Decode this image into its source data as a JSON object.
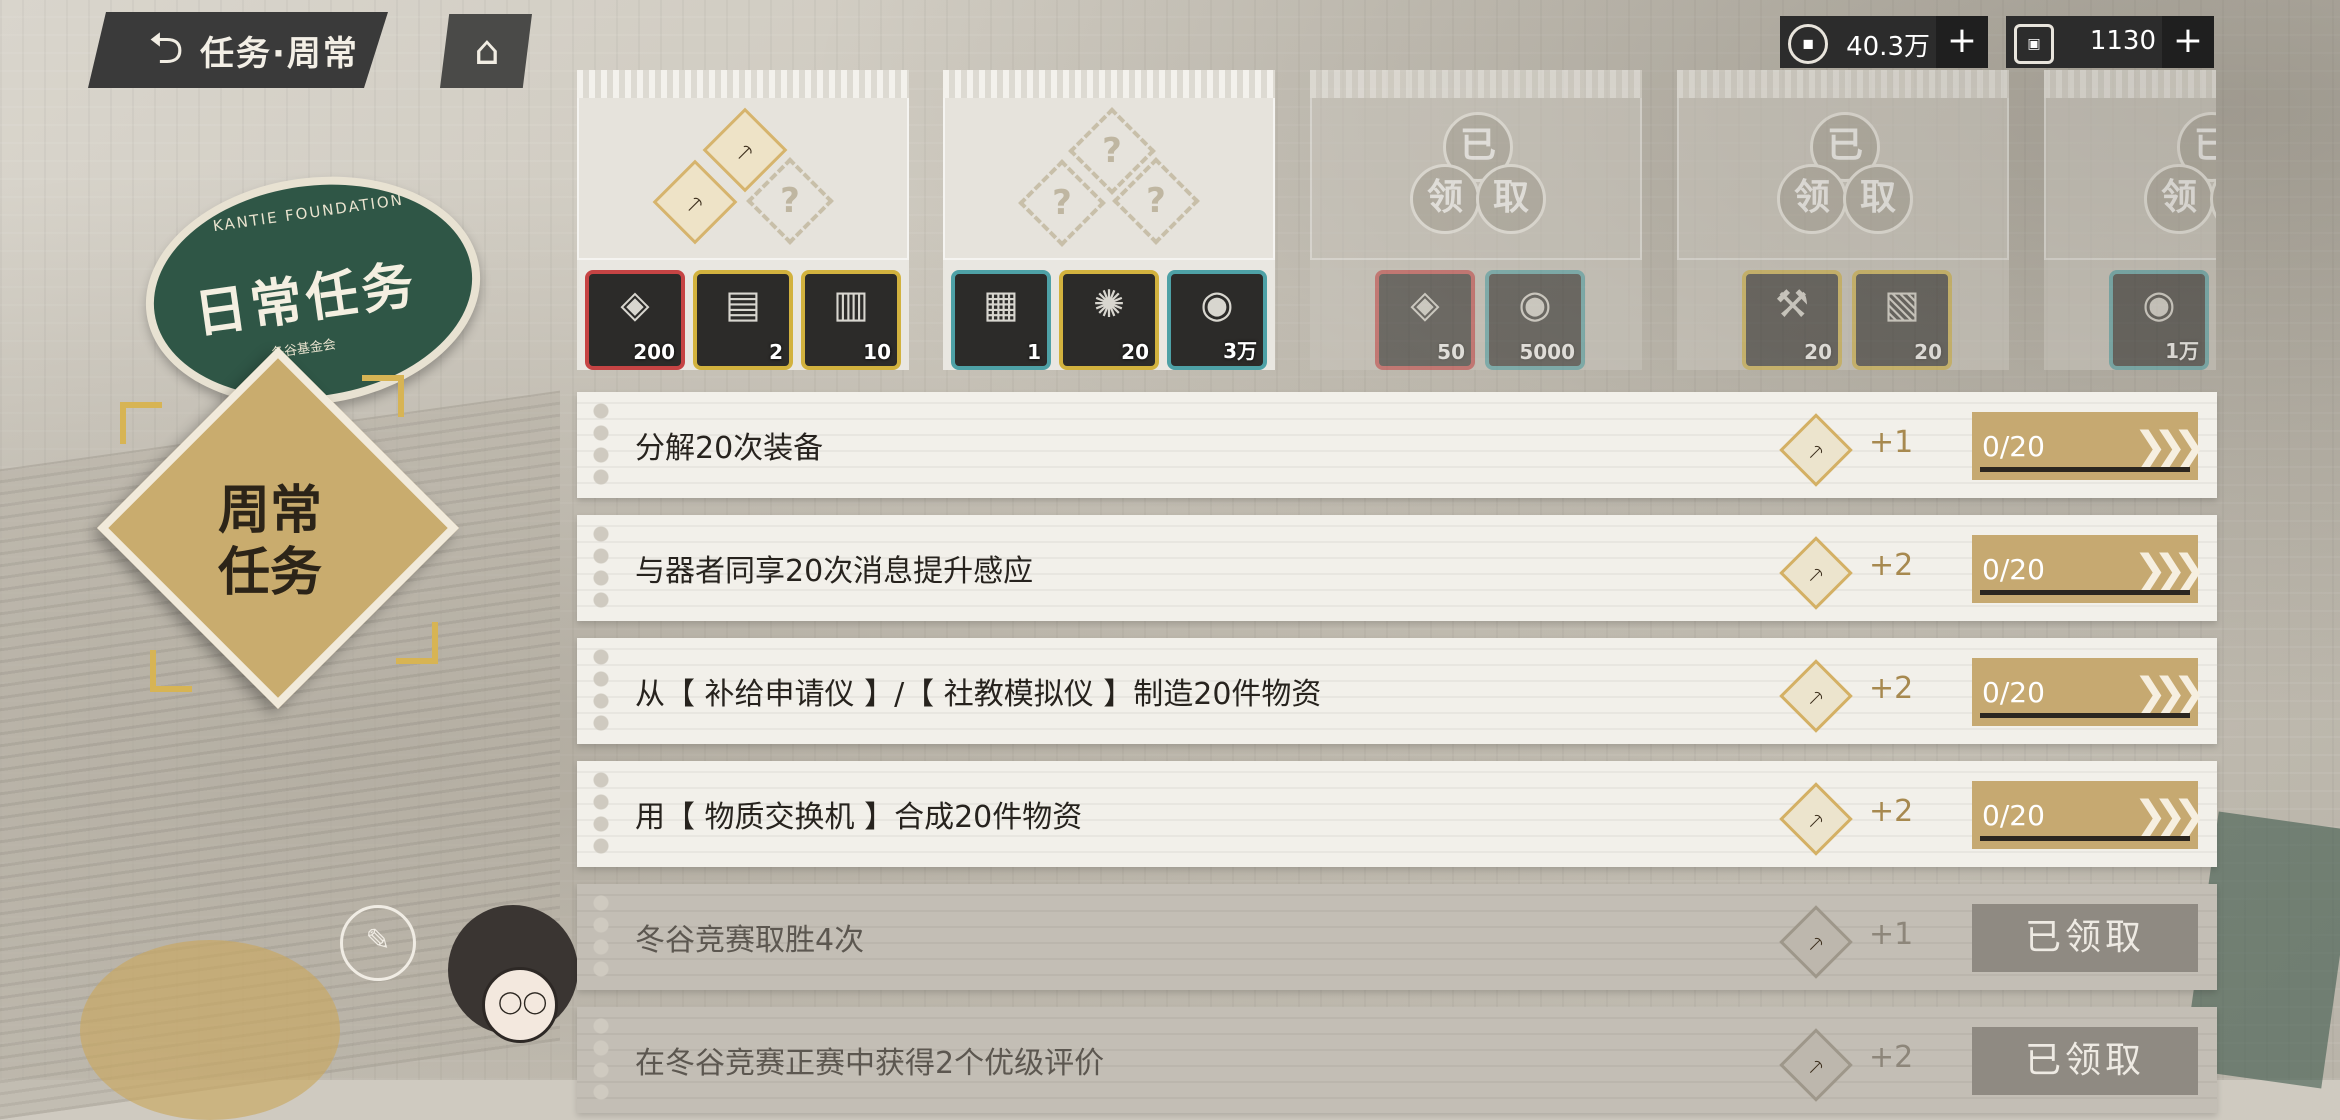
{
  "header": {
    "title": "任务·周常",
    "back_icon": "back-arrow-icon",
    "home_icon": "home-icon"
  },
  "resources": [
    {
      "icon": "coin-icon",
      "value": "40.3万",
      "add": "+"
    },
    {
      "icon": "token-icon",
      "value": "1130",
      "add": "+"
    }
  ],
  "left_panel": {
    "daily_badge": {
      "foundation": "KANTIE FOUNDATION",
      "label": "日常任务",
      "sub": "冬谷基金会"
    },
    "weekly_badge": {
      "label": "周常任务"
    }
  },
  "reward_cards": [
    {
      "state": "available",
      "items": [
        {
          "qty": "200",
          "rarity": "red"
        },
        {
          "qty": "2",
          "rarity": "gold"
        },
        {
          "qty": "10",
          "rarity": "gold"
        }
      ]
    },
    {
      "state": "available",
      "items": [
        {
          "qty": "1",
          "rarity": "gold"
        },
        {
          "qty": "20",
          "rarity": "gold"
        },
        {
          "qty": "3万",
          "rarity": "blue"
        }
      ]
    },
    {
      "state": "claimed",
      "seal": [
        "已",
        "领",
        "取"
      ],
      "items": [
        {
          "qty": "50",
          "rarity": "red"
        },
        {
          "qty": "5000",
          "rarity": "blue"
        }
      ]
    },
    {
      "state": "claimed",
      "seal": [
        "已",
        "领",
        "取"
      ],
      "items": [
        {
          "qty": "20",
          "rarity": "gold"
        },
        {
          "qty": "20",
          "rarity": "gold"
        }
      ]
    },
    {
      "state": "claimed",
      "seal": [
        "已",
        "领",
        "取"
      ],
      "items": [
        {
          "qty": "1万",
          "rarity": "blue"
        }
      ]
    }
  ],
  "tasks": [
    {
      "label": "分解20次装备",
      "points": "+1",
      "progress": "0/20",
      "state": "progress"
    },
    {
      "label": "与器者同享20次消息提升感应",
      "points": "+2",
      "progress": "0/20",
      "state": "progress"
    },
    {
      "label": "从【 补给申请仪 】/【 社教模拟仪 】制造20件物资",
      "points": "+2",
      "progress": "0/20",
      "state": "progress"
    },
    {
      "label": "用【 物质交换机 】合成20件物资",
      "points": "+2",
      "progress": "0/20",
      "state": "progress"
    },
    {
      "label": "冬谷竞赛取胜4次",
      "points": "+1",
      "status": "已领取",
      "state": "claimed"
    },
    {
      "label": "在冬谷竞赛正赛中获得2个优级评价",
      "points": "+2",
      "status": "已领取",
      "state": "claimed"
    }
  ],
  "colors": {
    "accent_gold": "#c6a971",
    "badge_green": "#2f5646",
    "claimed_gray": "#8f8a82",
    "rarity_red": "#c64444",
    "rarity_gold": "#d2b23e",
    "rarity_blue": "#4ea1a6"
  }
}
